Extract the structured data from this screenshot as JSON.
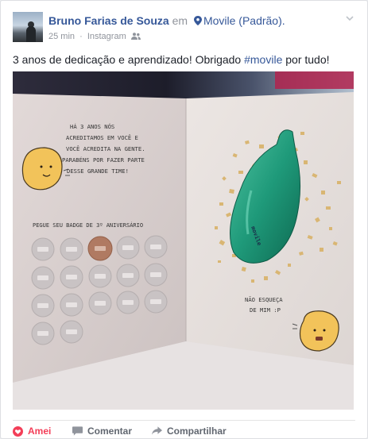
{
  "post": {
    "author": "Bruno Farias de Souza",
    "connector": "em",
    "place": "Movile (Padrão).",
    "time": "25 min",
    "separator": "·",
    "source": "Instagram",
    "text_before": "3 anos de dedicação e aprendizado! Obrigado ",
    "hashtag": "#movile",
    "text_after": " por tudo!"
  },
  "photo": {
    "card_left_text": "HÁ 3 ANOS NÓS ACREDITAMOS EM VOCÊ E VOCÊ ACREDITA NA GENTE. PARABÉNS POR FAZER PARTE DESSE GRANDE TIME!",
    "badge_caption": "PEGUE SEU BADGE DE 3º ANIVERSÁRIO",
    "card_right_text": "NÃO ESQUEÇA DE MIM :P",
    "balloon_text": "movile"
  },
  "actions": {
    "like_label": "Amei",
    "comment_label": "Comentar",
    "share_label": "Compartilhar"
  },
  "colors": {
    "link": "#365899",
    "love": "#f33e58",
    "balloon": "#1f9a7a",
    "mascot": "#f2c35a"
  }
}
